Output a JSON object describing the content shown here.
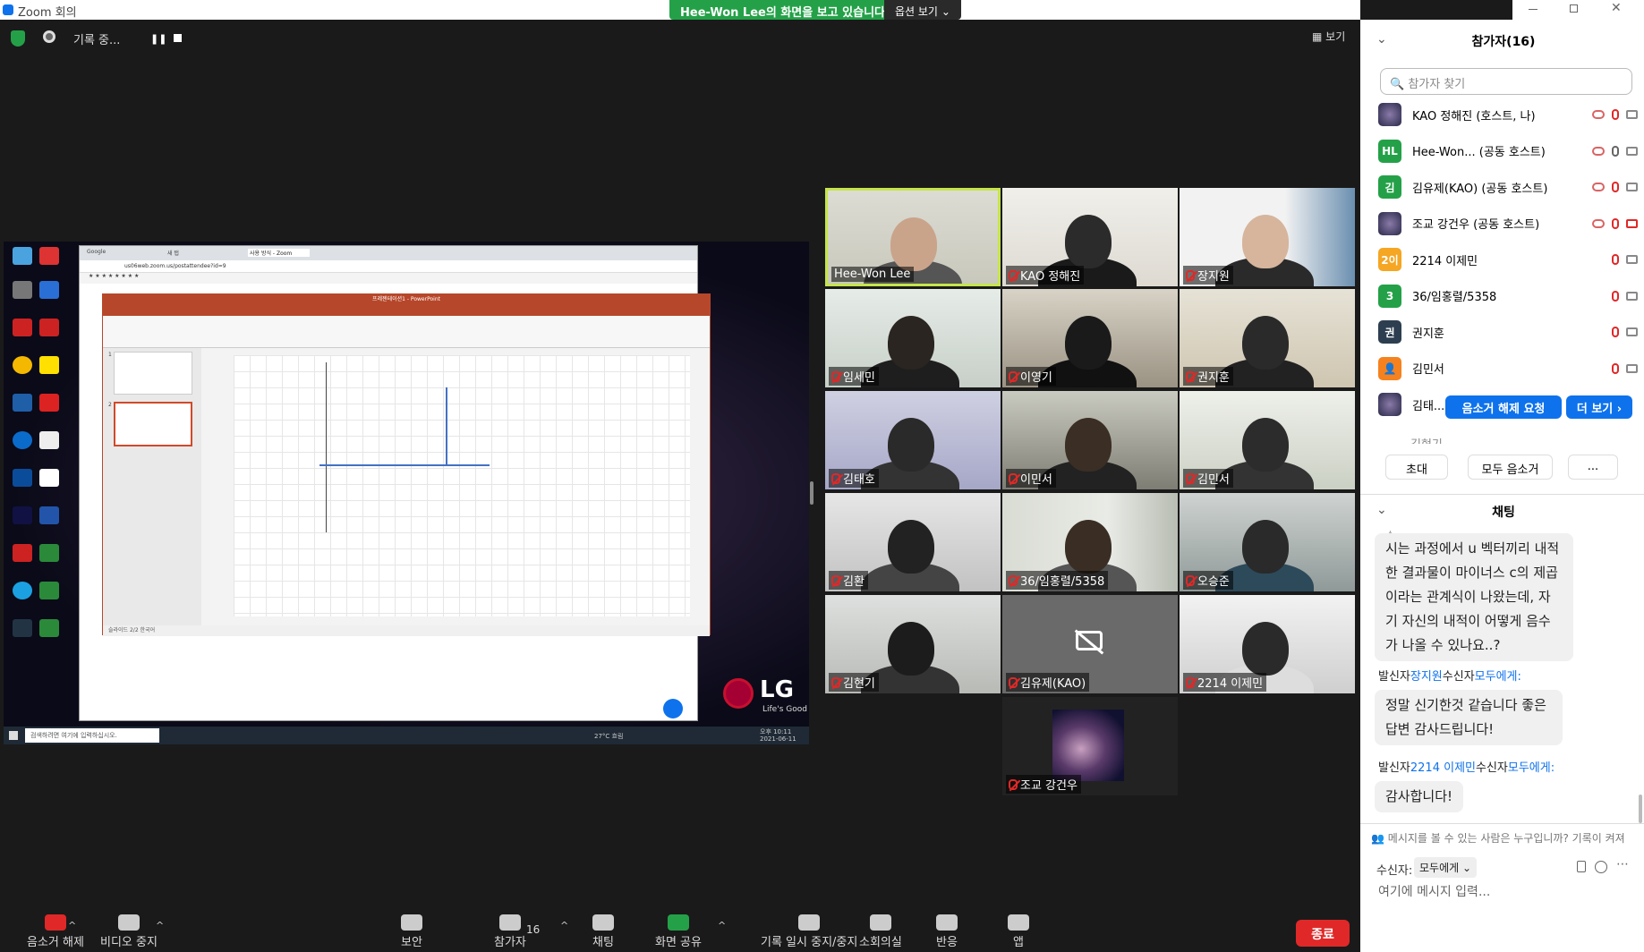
{
  "window": {
    "title": "Zoom 회의",
    "share_banner": "Hee-Won Lee의 화면을 보고 있습니다.",
    "view_options": "옵션 보기",
    "recording": "기록 중...",
    "view_button": "보기"
  },
  "shared_screen": {
    "browser_tabs": [
      "Google",
      "새 탭",
      "사용 방식 - Zoom"
    ],
    "url": "us06web.zoom.us/postattendee?id=9",
    "ppt_title": "프레젠테이션1 - PowerPoint",
    "taskbar_search": "검색하려면 여기에 입력하십시오.",
    "lg_text": "LG",
    "lg_sub": "Life's Good",
    "taskbar_time": "오후 10:11",
    "taskbar_date": "2021-06-11",
    "taskbar_temp": "27°C 흐림",
    "slide_numbers": [
      "1",
      "2"
    ],
    "status_text": "슬라이드 2/2 한국어"
  },
  "video_tiles": [
    {
      "name": "Hee-Won Lee",
      "muted": false,
      "active": true
    },
    {
      "name": "KAO 정해진",
      "muted": true
    },
    {
      "name": "장지원",
      "muted": true
    },
    {
      "name": "임세민",
      "muted": true
    },
    {
      "name": "이영기",
      "muted": true
    },
    {
      "name": "권지훈",
      "muted": true
    },
    {
      "name": "김태호",
      "muted": true
    },
    {
      "name": "이민서",
      "muted": true
    },
    {
      "name": "김민서",
      "muted": true
    },
    {
      "name": "김환",
      "muted": true
    },
    {
      "name": "36/임홍렬/5358",
      "muted": true
    },
    {
      "name": "오승준",
      "muted": true
    },
    {
      "name": "김현기",
      "muted": true
    },
    {
      "name": "김유제(KAO)",
      "muted": true,
      "video_off": true
    },
    {
      "name": "2214 이제민",
      "muted": true
    },
    {
      "name": "조교 강건우",
      "muted": true
    }
  ],
  "participants_panel": {
    "title": "참가자(16)",
    "search_placeholder": "참가자 찾기",
    "rows": [
      {
        "name": "KAO 정해진 (호스트, 나)",
        "avatar": "img",
        "color": "#3b3b6b"
      },
      {
        "name": "Hee-Won... (공동 호스트)",
        "avatar": "HL",
        "color": "#24a148"
      },
      {
        "name": "김유제(KAO) (공동 호스트)",
        "avatar": "김",
        "color": "#24a148"
      },
      {
        "name": "조교 강건우 (공동 호스트)",
        "avatar": "img",
        "color": "#3b3b6b"
      },
      {
        "name": "2214 이제민",
        "avatar": "2이",
        "color": "#f5a623"
      },
      {
        "name": "36/임홍렬/5358",
        "avatar": "3",
        "color": "#24a148"
      },
      {
        "name": "권지훈",
        "avatar": "권",
        "color": "#2d3e50"
      },
      {
        "name": "김민서",
        "avatar": "👤",
        "color": "#f5821f"
      },
      {
        "name": "김태...",
        "avatar": "img",
        "color": "#888888"
      }
    ],
    "partial_row": "김현기",
    "unmute_request": "음소거 해제 요청",
    "more": "더 보기 ›",
    "invite": "초대",
    "mute_all": "모두 음소거",
    "ellipsis": "..."
  },
  "chat": {
    "title": "채팅",
    "message1": "시는 과정에서 u 벡터끼리 내적한 결과물이 마이너스 c의 제곱이라는 관계식이 나왔는데, 자기 자신의 내적이 어떻게 음수가 나올 수 있나요..?",
    "message1_top": "수 ...",
    "sender2_label_from": "발신자",
    "sender2_name": "장지원",
    "sender2_label_to": "수신자",
    "sender2_target": "모두에게:",
    "message2": "정말 신기한것 같습니다 좋은 답변 감사드립니다!",
    "sender3_name": "2214 이제민",
    "message3": "감사합니다!",
    "scope_note": "메시지를 볼 수 있는 사람은 누구입니까? 기록이 켜져",
    "recipient_label": "수신자:",
    "recipient_value": "모두에게",
    "input_placeholder": "여기에 메시지 입력..."
  },
  "toolbar": {
    "unmute": "음소거 해제",
    "video_stop": "비디오 중지",
    "security": "보안",
    "participants": "참가자",
    "participants_count": "16",
    "chat": "채팅",
    "share_screen": "화면 공유",
    "pause_record": "기록 일시 중지/중지",
    "breakout": "소회의실",
    "reactions": "반응",
    "apps": "앱",
    "end": "종료"
  },
  "colors": {
    "zoom_blue": "#0e72ed",
    "green": "#24a148",
    "red": "#e02828",
    "active_speaker": "#c6e54b"
  }
}
